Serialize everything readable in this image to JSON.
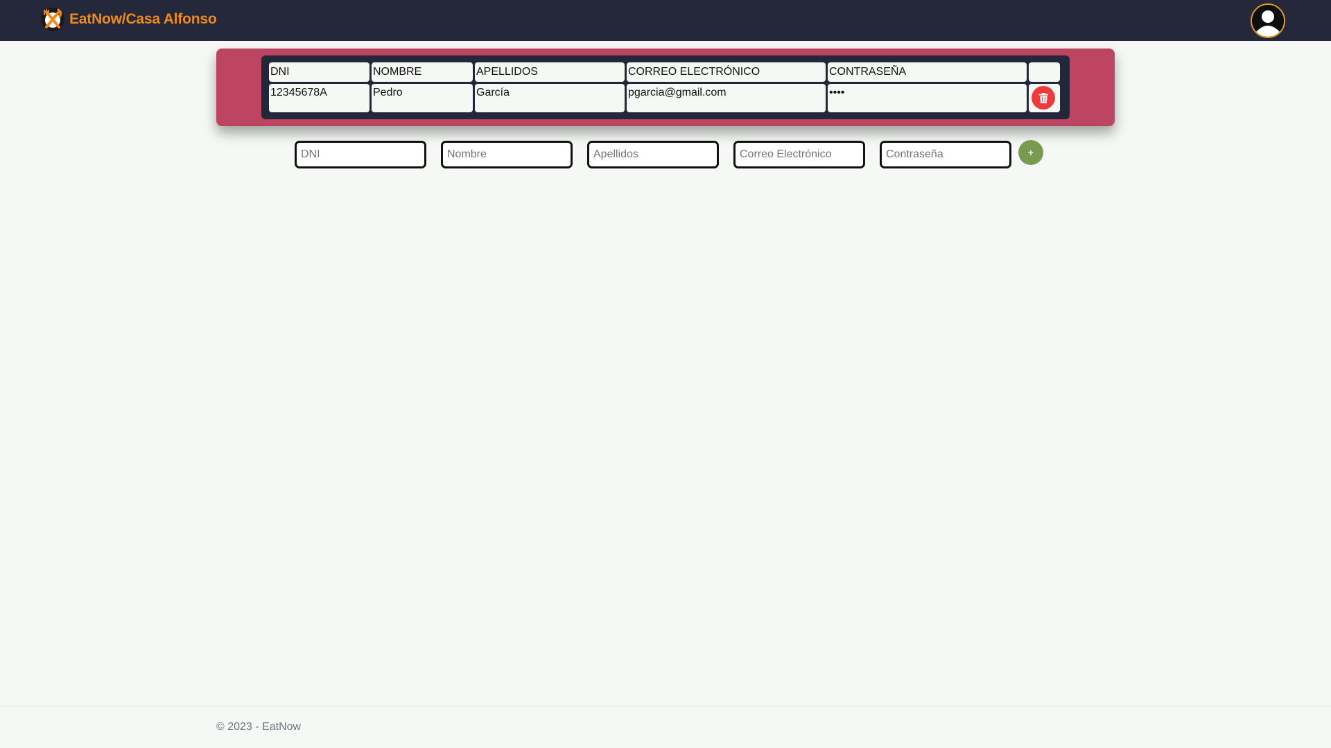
{
  "header": {
    "brand_name": "EatNow/Casa Alfonso",
    "logo_icon": "fork-knife-logo-icon",
    "profile_icon": "user-avatar-icon",
    "colors": {
      "navbar_bg": "#24283a",
      "brand": "#f08a1c",
      "avatar_border": "#e39b1b"
    }
  },
  "table": {
    "headers": [
      "DNI",
      "NOMBRE",
      "APELLIDOS",
      "CORREO ELECTRÓNICO",
      "CONTRASEÑA",
      ""
    ],
    "rows": [
      {
        "dni": "12345678A",
        "nombre": "Pedro",
        "apellidos": "García",
        "correo": "pgarcia@gmail.com",
        "contrasena": "••••",
        "delete_icon": "trash-icon"
      }
    ],
    "colors": {
      "card_bg": "#bd4561",
      "table_bg": "#23273a",
      "delete_btn": "#ee3a3a"
    }
  },
  "form": {
    "dni_placeholder": "DNI",
    "nombre_placeholder": "Nombre",
    "apellidos_placeholder": "Apellidos",
    "correo_placeholder": "Correo Electrónico",
    "contrasena_placeholder": "Contraseña",
    "add_label": "+",
    "add_color": "#7a9a50"
  },
  "footer": {
    "text": "© 2023 - EatNow"
  }
}
